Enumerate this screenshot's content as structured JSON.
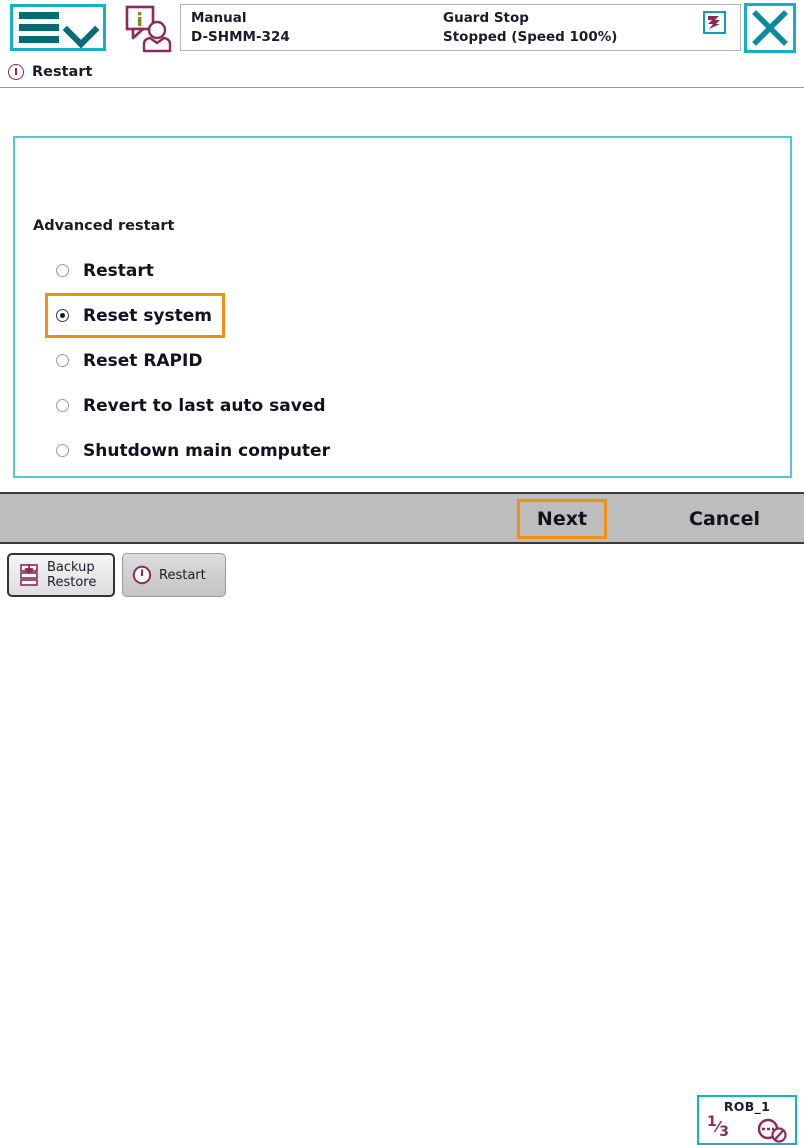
{
  "window": {
    "menu_button_label": "main-menu",
    "close_button_label": "close"
  },
  "status_bar": {
    "operating_mode": "Manual",
    "system_name": "D-SHMM-324",
    "controller_state": "Guard Stop",
    "speed_state": "Stopped (Speed 100%)",
    "stop_icon": "guard-stop-icon"
  },
  "page": {
    "title": "Restart",
    "title_icon": "info-circle-icon"
  },
  "group": {
    "legend": "Advanced restart",
    "options": [
      {
        "label": "Restart",
        "checked": false,
        "focused": false
      },
      {
        "label": "Reset system",
        "checked": true,
        "focused": true
      },
      {
        "label": "Reset RAPID",
        "checked": false,
        "focused": false
      },
      {
        "label": "Revert to last auto saved",
        "checked": false,
        "focused": false
      },
      {
        "label": "Shutdown main computer",
        "checked": false,
        "focused": false
      }
    ]
  },
  "actions": {
    "next_label": "Next",
    "cancel_label": "Cancel"
  },
  "taskbar": {
    "items": [
      {
        "line1": "Backup",
        "line2": "Restore",
        "icon": "backup-restore-icon"
      },
      {
        "line1": "Restart",
        "line2": "",
        "icon": "restart-power-icon"
      }
    ]
  },
  "robot_status": {
    "name": "ROB_1",
    "numerator": "1",
    "denominator": "3",
    "icon": "motors-off-icon"
  },
  "colors": {
    "accent_teal": "#14b1c4",
    "group_border": "#4ec8da",
    "focus_orange": "#f29111",
    "icon_maroon": "#8e2a5a",
    "bar_gray": "#bdbdbd",
    "text_dark": "#12121f"
  }
}
